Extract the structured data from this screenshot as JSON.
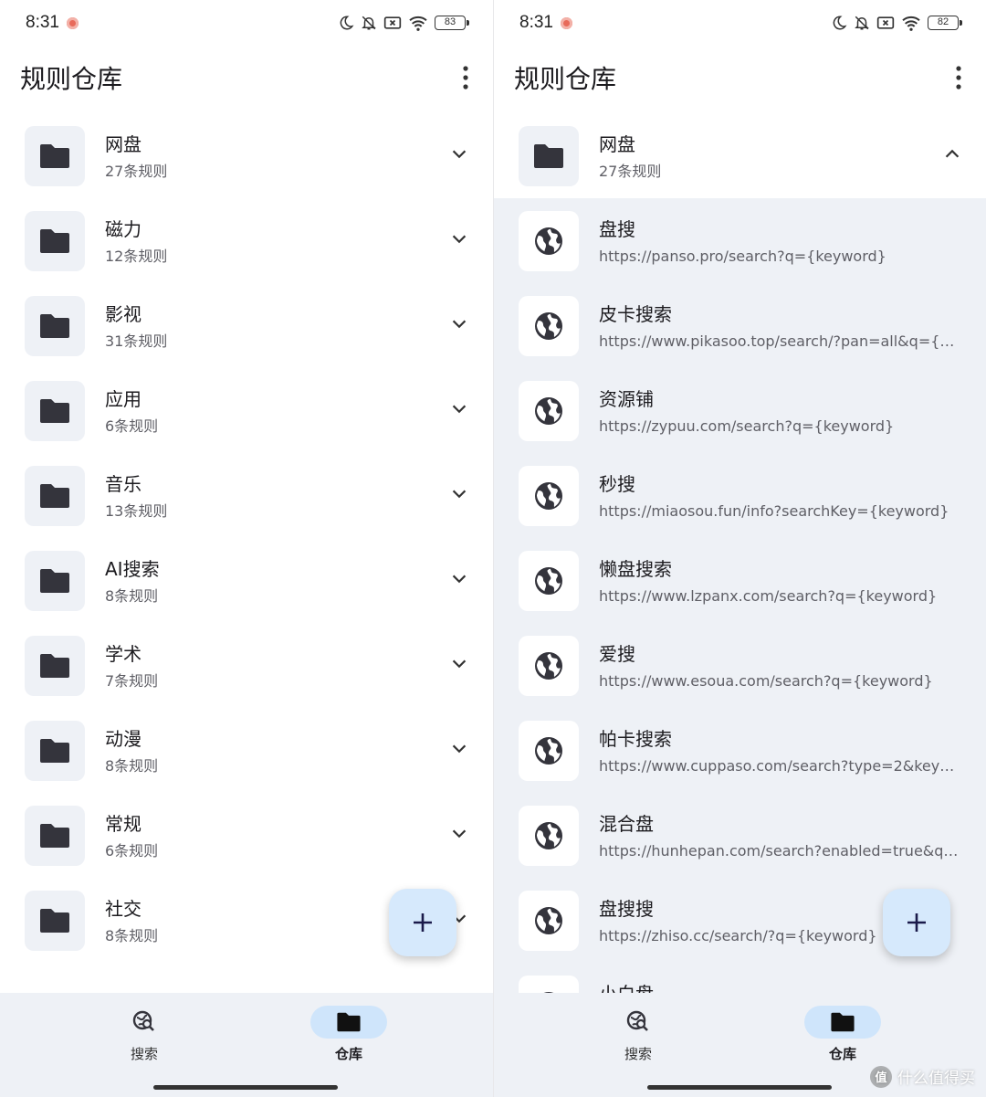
{
  "left_screen": {
    "status": {
      "time": "8:31",
      "battery": "83"
    },
    "title": "规则仓库",
    "groups": [
      {
        "name": "网盘",
        "count": "27条规则"
      },
      {
        "name": "磁力",
        "count": "12条规则"
      },
      {
        "name": "影视",
        "count": "31条规则"
      },
      {
        "name": "应用",
        "count": "6条规则"
      },
      {
        "name": "音乐",
        "count": "13条规则"
      },
      {
        "name": "AI搜索",
        "count": "8条规则"
      },
      {
        "name": "学术",
        "count": "7条规则"
      },
      {
        "name": "动漫",
        "count": "8条规则"
      },
      {
        "name": "常规",
        "count": "6条规则"
      },
      {
        "name": "社交",
        "count": "8条规则"
      }
    ],
    "fab_icon": "plus-icon",
    "nav": {
      "search_label": "搜索",
      "repo_label": "仓库",
      "active": "repo"
    }
  },
  "right_screen": {
    "status": {
      "time": "8:31",
      "battery": "82"
    },
    "title": "规则仓库",
    "expanded_group": {
      "name": "网盘",
      "count": "27条规则"
    },
    "rules": [
      {
        "name": "盘搜",
        "url": "https://panso.pro/search?q={keyword}"
      },
      {
        "name": "皮卡搜索",
        "url": "https://www.pikasoo.top/search/?pan=all&q={keyw…"
      },
      {
        "name": "资源铺",
        "url": "https://zypuu.com/search?q={keyword}"
      },
      {
        "name": "秒搜",
        "url": "https://miaosou.fun/info?searchKey={keyword}"
      },
      {
        "name": "懒盘搜索",
        "url": "https://www.lzpanx.com/search?q={keyword}"
      },
      {
        "name": "爱搜",
        "url": "https://www.esoua.com/search?q={keyword}"
      },
      {
        "name": "帕卡搜索",
        "url": "https://www.cuppaso.com/search?type=2&keyword…"
      },
      {
        "name": "混合盘",
        "url": "https://hunhepan.com/search?enabled=true&q={ke…"
      },
      {
        "name": "盘搜搜",
        "url": "https://zhiso.cc/search/?q={keyword}"
      },
      {
        "name": "小白盘",
        "url": ""
      }
    ],
    "fab_icon": "plus-icon",
    "nav": {
      "search_label": "搜索",
      "repo_label": "仓库",
      "active": "repo"
    }
  },
  "watermark": {
    "text": "什么值得买",
    "logo": "值"
  },
  "colors": {
    "accent_pill": "#cfe5fb",
    "fab": "#d6e9fc",
    "panel": "#eef1f6",
    "icon_dark": "#34343c"
  }
}
